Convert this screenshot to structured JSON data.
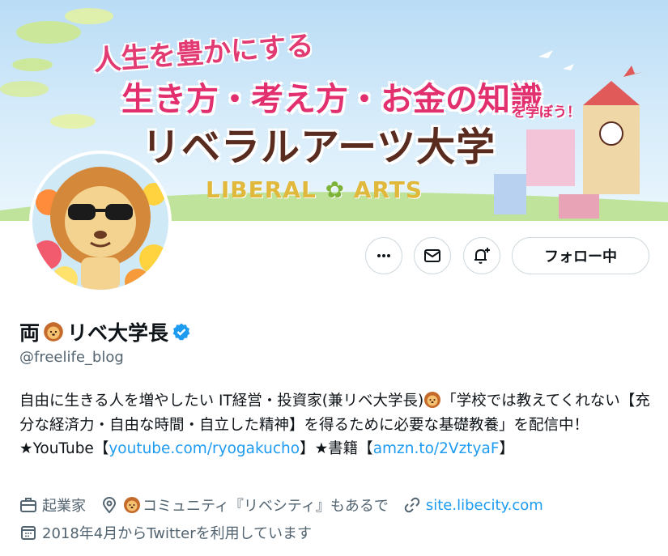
{
  "banner": {
    "line1": "人生を豊かにする",
    "line2": "生き方・考え方・お金の知識",
    "line2_suffix": "を学ぼう！",
    "line3": "リベラルアーツ大学",
    "logo_left": "LIBERAL",
    "logo_right": "ARTS"
  },
  "actions": {
    "more_icon": "more-icon",
    "message_icon": "mail-icon",
    "notify_icon": "bell-plus-icon",
    "follow_label": "フォロー中"
  },
  "profile": {
    "name_prefix": "両",
    "name_suffix": "リベ大学長",
    "handle": "@freelife_blog",
    "bio_1": "自由に生きる人を増やしたい IT経営・投資家(兼リベ大学長)",
    "bio_2": "「学校では教えてくれない【充分な経済力・自由な時間・自立した精神】を得るために必要な基礎教養」を配信中！ ★YouTube【",
    "bio_link1": "youtube.com/ryogakucho",
    "bio_3": "】★書籍【",
    "bio_link2": "amzn.to/2VztyaF",
    "bio_4": "】",
    "occupation": "起業家",
    "location": "コミュニティ『リベシティ』もあるで",
    "website": "site.libecity.com",
    "joined": "2018年4月からTwitterを利用しています"
  },
  "colors": {
    "link": "#1d9bf0",
    "verified": "#1d9bf0",
    "muted": "#536471",
    "text": "#0f1419"
  }
}
